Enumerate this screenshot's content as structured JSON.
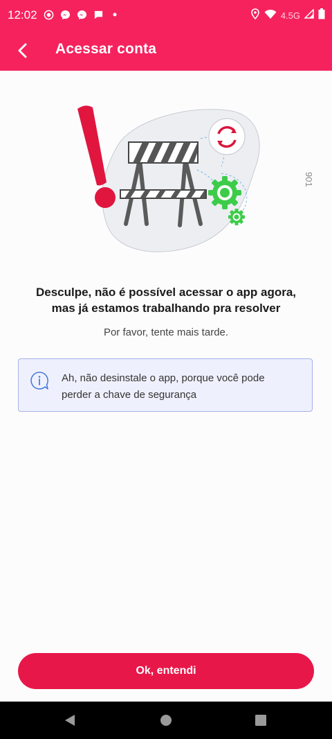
{
  "status_bar": {
    "time": "12:02",
    "network": "4.5G",
    "icons": [
      "record-icon",
      "messenger-icon",
      "messenger-icon",
      "chat-bubble-icon",
      "dot-icon",
      "location-icon",
      "wifi-icon",
      "signal-icon",
      "battery-icon"
    ]
  },
  "app_bar": {
    "title": "Acessar conta",
    "back_icon": "chevron-left-icon"
  },
  "illustration": {
    "code": "901"
  },
  "message": {
    "headline_line1": "Desculpe, não é possível acessar o app agora,",
    "headline_line2": "mas já estamos trabalhando pra resolver",
    "subtext": "Por favor, tente mais tarde."
  },
  "info_box": {
    "icon": "info-bubble-icon",
    "line1": "Ah, não desinstale o app, porque você pode",
    "line2": "perder a chave de segurança"
  },
  "actions": {
    "ok_label": "Ok, entendi"
  },
  "colors": {
    "brand": "#f5225e",
    "button": "#e8174a",
    "info_bg": "#eef1fd",
    "info_border": "#a5b0e6",
    "gear_green": "#3dcc4a"
  }
}
